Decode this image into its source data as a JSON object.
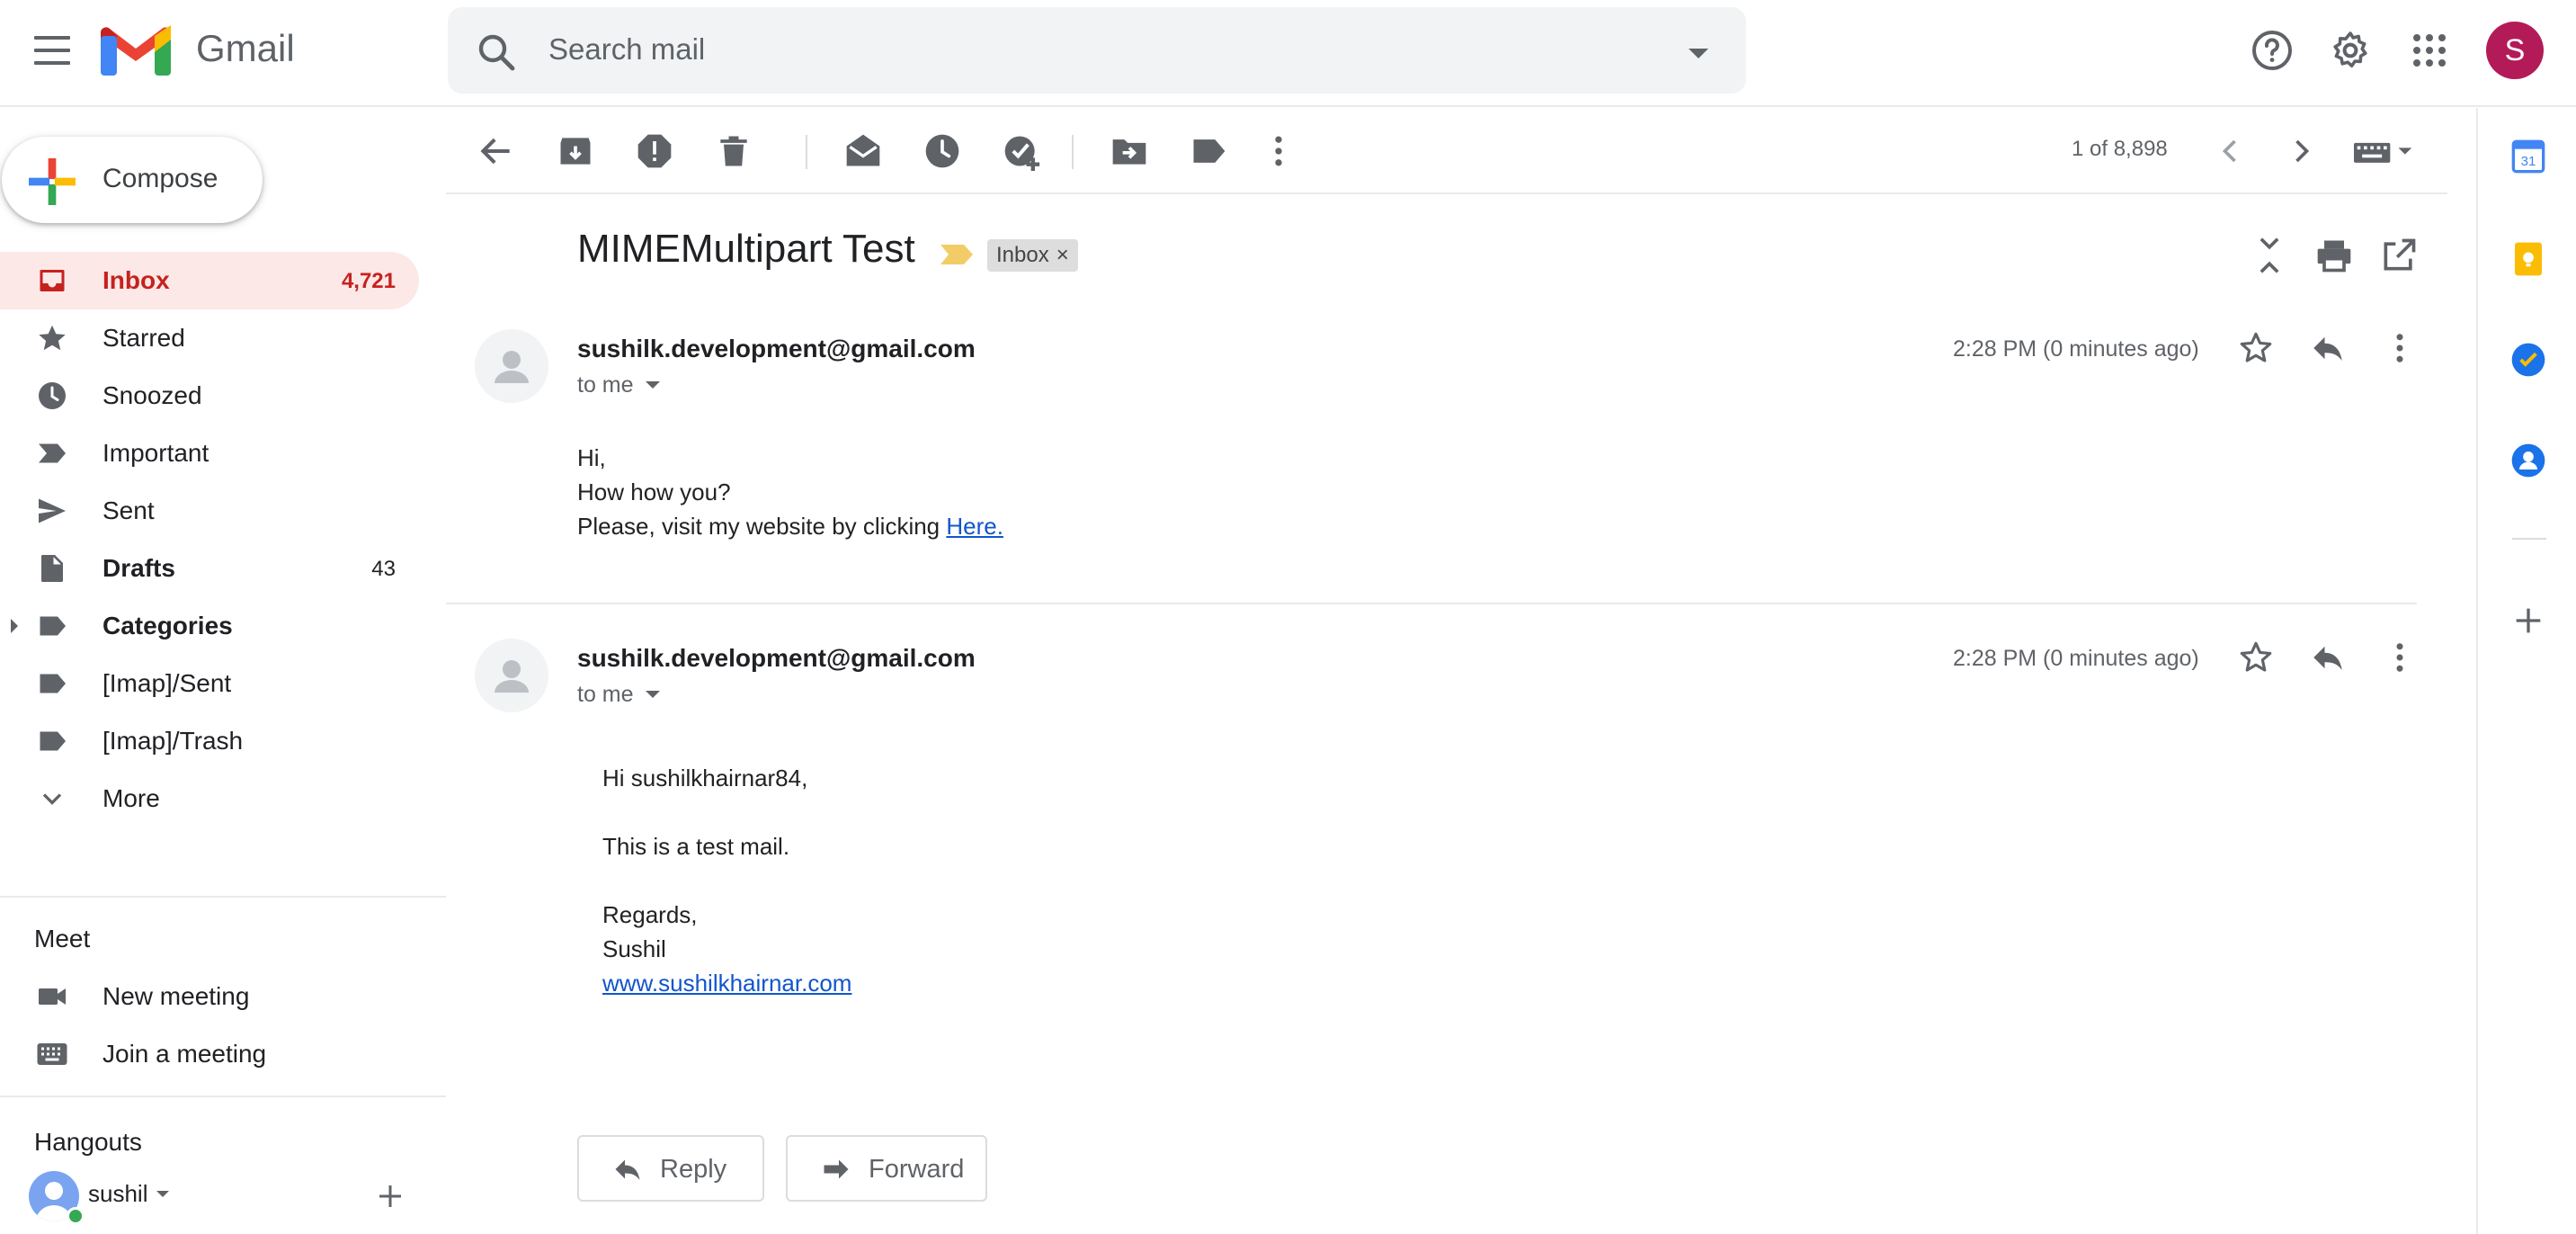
{
  "app": {
    "name": "Gmail"
  },
  "search": {
    "placeholder": "Search mail"
  },
  "header": {
    "avatar_letter": "S"
  },
  "compose": {
    "label": "Compose"
  },
  "nav": [
    {
      "label": "Inbox",
      "count": "4,721",
      "icon": "inbox-icon",
      "active": true
    },
    {
      "label": "Starred",
      "count": "",
      "icon": "star-icon"
    },
    {
      "label": "Snoozed",
      "count": "",
      "icon": "clock-icon"
    },
    {
      "label": "Important",
      "count": "",
      "icon": "important-icon"
    },
    {
      "label": "Sent",
      "count": "",
      "icon": "send-icon"
    },
    {
      "label": "Drafts",
      "count": "43",
      "icon": "draft-icon"
    },
    {
      "label": "Categories",
      "count": "",
      "icon": "label-icon"
    },
    {
      "label": "[Imap]/Sent",
      "count": "",
      "icon": "label-icon"
    },
    {
      "label": "[Imap]/Trash",
      "count": "",
      "icon": "label-icon"
    },
    {
      "label": "More",
      "count": "",
      "icon": "chevron-down-icon"
    }
  ],
  "meet": {
    "title": "Meet",
    "new_meeting": "New meeting",
    "join_meeting": "Join a meeting"
  },
  "hangouts": {
    "title": "Hangouts",
    "user": "sushil"
  },
  "toolbar": {
    "pager": "1 of 8,898"
  },
  "thread": {
    "subject": "MIMEMultipart Test",
    "label_chip": "Inbox",
    "label_chip_close": "×",
    "messages": [
      {
        "sender": "sushilk.development@gmail.com",
        "to": "to me",
        "time": "2:28 PM (0 minutes ago)",
        "body": {
          "line1": "Hi,",
          "line2": "How how you?",
          "line3_prefix": "Please, visit my website by clicking ",
          "line3_link": "Here."
        }
      },
      {
        "sender": "sushilk.development@gmail.com",
        "to": "to me",
        "time": "2:28 PM (0 minutes ago)",
        "body": {
          "greeting": "Hi sushilkhairnar84,",
          "text": "This is a test mail.",
          "regards": "Regards,",
          "name": "Sushil",
          "link": "www.sushilkhairnar.com"
        }
      }
    ]
  },
  "actions": {
    "reply": "Reply",
    "forward": "Forward"
  },
  "side_panel": {
    "calendar_day": "31"
  },
  "colors": {
    "accent_red": "#c5221f",
    "inbox_active_bg": "#fce8e6",
    "link": "#1155cc",
    "avatar": "#b31b58",
    "keep_yellow": "#fbbc04",
    "tasks_blue": "#1a73e8"
  }
}
